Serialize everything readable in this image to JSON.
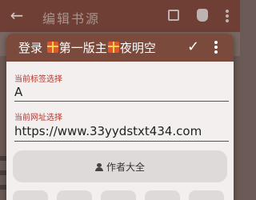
{
  "background": {
    "title": "编辑书源"
  },
  "dialog": {
    "title_prefix": "登录",
    "title_part1": "第一版主",
    "title_part2": "夜明空",
    "tag_label": "当前标签选择",
    "tag_value": "A",
    "url_label": "当前网址选择",
    "url_value": "https://www.33yydstxt434.com",
    "author_button": "作者大全"
  },
  "colors": {
    "toolbar": "#7a4a3d",
    "label": "#b03a32",
    "background_appbar": "#6f3f35"
  },
  "icons": [
    "back-arrow-icon",
    "save-icon",
    "bug-icon",
    "more-vert-icon",
    "gift-icon",
    "check-icon",
    "person-icon"
  ]
}
